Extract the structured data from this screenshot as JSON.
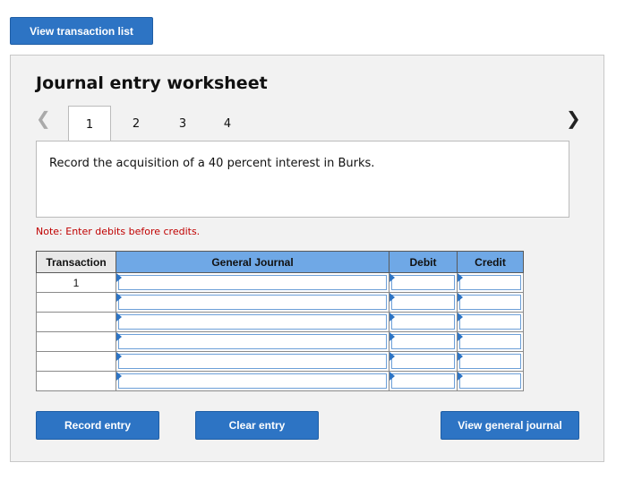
{
  "top_button": {
    "label": "View transaction list"
  },
  "worksheet": {
    "title": "Journal entry worksheet",
    "nav": {
      "prev_icon": "chevron-left-icon",
      "next_icon": "chevron-right-icon"
    },
    "tabs": [
      {
        "label": "1",
        "active": true
      },
      {
        "label": "2",
        "active": false
      },
      {
        "label": "3",
        "active": false
      },
      {
        "label": "4",
        "active": false
      }
    ],
    "prompt": "Record the acquisition of a 40 percent interest in Burks.",
    "note": "Note: Enter debits before credits.",
    "table": {
      "headers": [
        "Transaction",
        "General Journal",
        "Debit",
        "Credit"
      ],
      "rows": [
        {
          "transaction": "1",
          "general_journal": "",
          "debit": "",
          "credit": ""
        },
        {
          "transaction": "",
          "general_journal": "",
          "debit": "",
          "credit": ""
        },
        {
          "transaction": "",
          "general_journal": "",
          "debit": "",
          "credit": ""
        },
        {
          "transaction": "",
          "general_journal": "",
          "debit": "",
          "credit": ""
        },
        {
          "transaction": "",
          "general_journal": "",
          "debit": "",
          "credit": ""
        },
        {
          "transaction": "",
          "general_journal": "",
          "debit": "",
          "credit": ""
        }
      ]
    },
    "buttons": {
      "record": "Record entry",
      "clear": "Clear entry",
      "view_journal": "View general journal"
    }
  },
  "colors": {
    "button_blue": "#2d74c4",
    "header_blue": "#6fa8e6",
    "note_red": "#c00000",
    "panel_gray": "#f2f2f2"
  }
}
